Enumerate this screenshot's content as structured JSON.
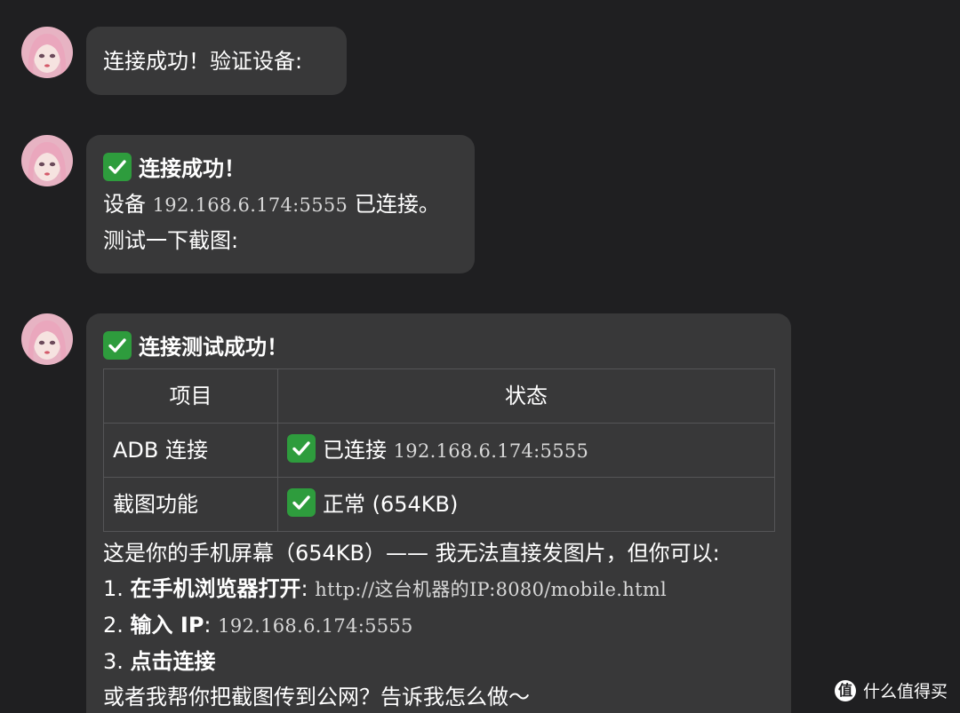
{
  "messages": [
    {
      "text": "连接成功！验证设备:"
    },
    {
      "title": "连接成功！",
      "line1_prefix": "设备",
      "line1_ip": "192.168.6.174:5555",
      "line1_suffix": "已连接。",
      "line2": "测试一下截图:"
    },
    {
      "title": "连接测试成功！",
      "table": {
        "headers": [
          "项目",
          "状态"
        ],
        "rows": [
          {
            "item": "ADB 连接",
            "status": "已连接",
            "status_extra": "192.168.6.174:5555"
          },
          {
            "item": "截图功能",
            "status": "正常 (654KB)",
            "status_extra": ""
          }
        ]
      },
      "intro": "这是你的手机屏幕（654KB）—— 我无法直接发图片，但你可以:",
      "steps": [
        {
          "num": "1.",
          "label": "在手机浏览器打开",
          "sep": ":",
          "value": "http://这台机器的IP:8080/mobile.html"
        },
        {
          "num": "2.",
          "label": "输入 IP",
          "sep": ":",
          "value": "192.168.6.174:5555"
        },
        {
          "num": "3.",
          "label": "点击连接",
          "sep": "",
          "value": ""
        }
      ],
      "outro": "或者我帮你把截图传到公网？告诉我怎么做～"
    }
  ],
  "watermark": {
    "logo": "值",
    "text": "什么值得买"
  },
  "colors": {
    "background": "#1f1f21",
    "bubble": "#383839",
    "check": "#2e9c3d"
  },
  "icons": {
    "check": "white-heavy-check-mark-icon",
    "avatar": "avatar-pink-hair"
  }
}
